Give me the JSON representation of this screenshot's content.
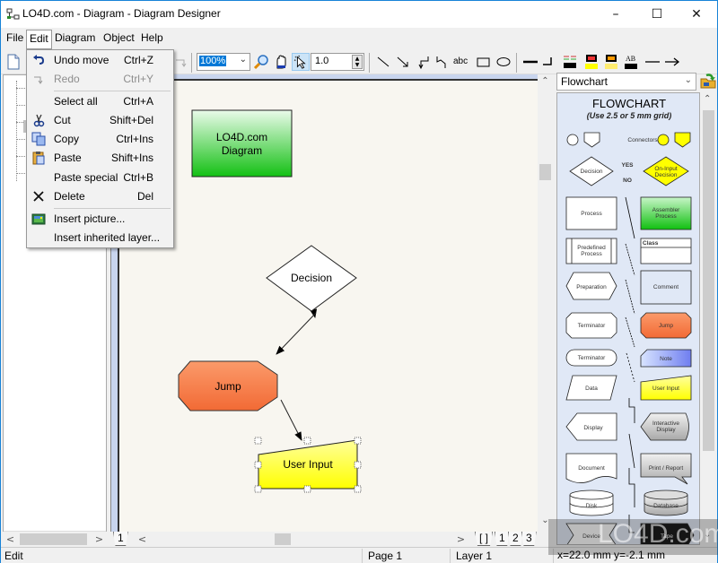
{
  "window": {
    "title": "LO4D.com - Diagram - Diagram Designer",
    "controls": {
      "minimize": "–",
      "maximize": "☐",
      "close": "✕"
    }
  },
  "menubar": {
    "items": [
      {
        "label": "File"
      },
      {
        "label": "Edit"
      },
      {
        "label": "Diagram"
      },
      {
        "label": "Object"
      },
      {
        "label": "Help"
      }
    ]
  },
  "edit_menu": {
    "items": [
      {
        "label": "Undo move",
        "shortcut": "Ctrl+Z",
        "icon": "undo-icon",
        "enabled": true
      },
      {
        "label": "Redo",
        "shortcut": "Ctrl+Y",
        "icon": "redo-icon",
        "enabled": false
      },
      {
        "label": "Select all",
        "shortcut": "Ctrl+A",
        "icon": "",
        "enabled": true
      },
      {
        "label": "Cut",
        "shortcut": "Shift+Del",
        "icon": "scissors-icon",
        "enabled": true
      },
      {
        "label": "Copy",
        "shortcut": "Ctrl+Ins",
        "icon": "copy-icon",
        "enabled": true
      },
      {
        "label": "Paste",
        "shortcut": "Shift+Ins",
        "icon": "paste-icon",
        "enabled": true
      },
      {
        "label": "Paste special",
        "shortcut": "Ctrl+B",
        "icon": "",
        "enabled": true
      },
      {
        "label": "Delete",
        "shortcut": "Del",
        "icon": "delete-icon",
        "enabled": true
      },
      {
        "label": "Insert picture...",
        "shortcut": "",
        "icon": "picture-icon",
        "enabled": true
      },
      {
        "label": "Insert inherited layer...",
        "shortcut": "",
        "icon": "",
        "enabled": true
      }
    ]
  },
  "toolbar": {
    "zoom_value": "100%",
    "line_width_value": "1.0",
    "text_tool_label": "abc",
    "text_style_label": "AB"
  },
  "library": {
    "selected": "Flowchart",
    "title": "FLOWCHART",
    "subtitle": "(Use 2.5 or 5 mm grid)",
    "shapes": {
      "connectors": "Connectors",
      "decision": "Decision",
      "yes": "YES",
      "no": "NO",
      "on_input_decision_1": "On-Input",
      "on_input_decision_2": "Decision",
      "process": "Process",
      "assembler_1": "Assembler",
      "assembler_2": "Process",
      "predefined_1": "Predefined",
      "predefined_2": "Process",
      "class": "Class",
      "preparation": "Preparation",
      "comment": "Comment",
      "terminator_a": "Terminator",
      "jump": "Jump",
      "terminator_b": "Terminator",
      "note": "Note",
      "data": "Data",
      "user_input": "User Input",
      "display": "Display",
      "interactive_1": "Interactive",
      "interactive_2": "Display",
      "document": "Document",
      "print_report": "Print / Report",
      "disk": "Disk",
      "database": "Database",
      "device": "Device",
      "tape": "Tape"
    }
  },
  "diagram": {
    "start_line1": "LO4D.com",
    "start_line2": "Diagram",
    "decision": "Decision",
    "jump": "Jump",
    "user_input": "User Input"
  },
  "page_tabs": [
    "[ ]",
    "1",
    "2",
    "3"
  ],
  "layer_tab": "1",
  "statusbar": {
    "mode": "Edit",
    "page": "Page 1",
    "layer": "Layer 1",
    "coords": "x=22.0 mm  y=-2.1 mm"
  },
  "colors": {
    "accent": "#0078d7",
    "start_fill": "#1ec31e",
    "jump_fill": "#f47a45",
    "user_input_fill": "#ffff33",
    "canvas_bg": "#f8f6f0",
    "library_bg": "#e0e8f6"
  },
  "watermark": "LO4D.com"
}
